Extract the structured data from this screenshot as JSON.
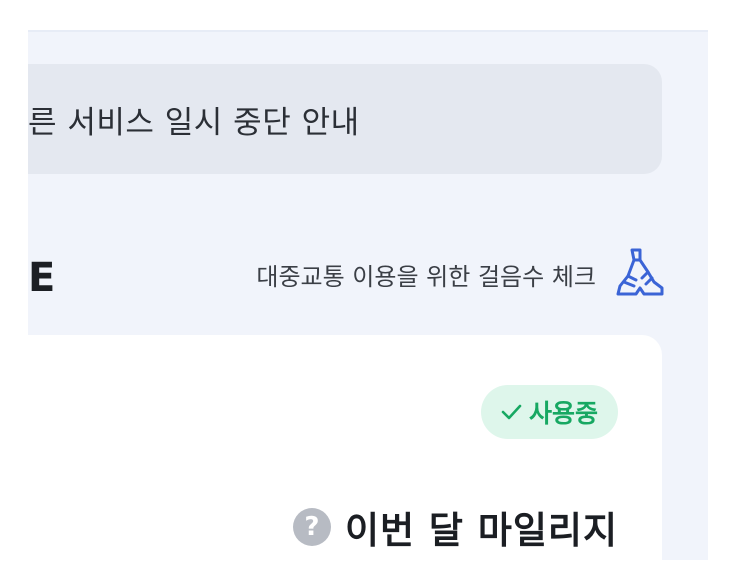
{
  "notice": {
    "text": "른 서비스 일시 중단 안내"
  },
  "section": {
    "title_fragment": "E"
  },
  "step_check": {
    "label": "대중교통 이용을 위한 걸음수 체크",
    "icon": "shoe-icon"
  },
  "card": {
    "badge": {
      "label": "사용중",
      "icon": "check-icon",
      "color": "#17a862",
      "background": "#def6eb"
    },
    "mileage": {
      "help_icon": "?",
      "title": "이번 달 마일리지"
    }
  },
  "colors": {
    "page_bg": "#f1f4fb",
    "notice_bg": "#e4e8f0",
    "accent_blue": "#3b64d6"
  }
}
